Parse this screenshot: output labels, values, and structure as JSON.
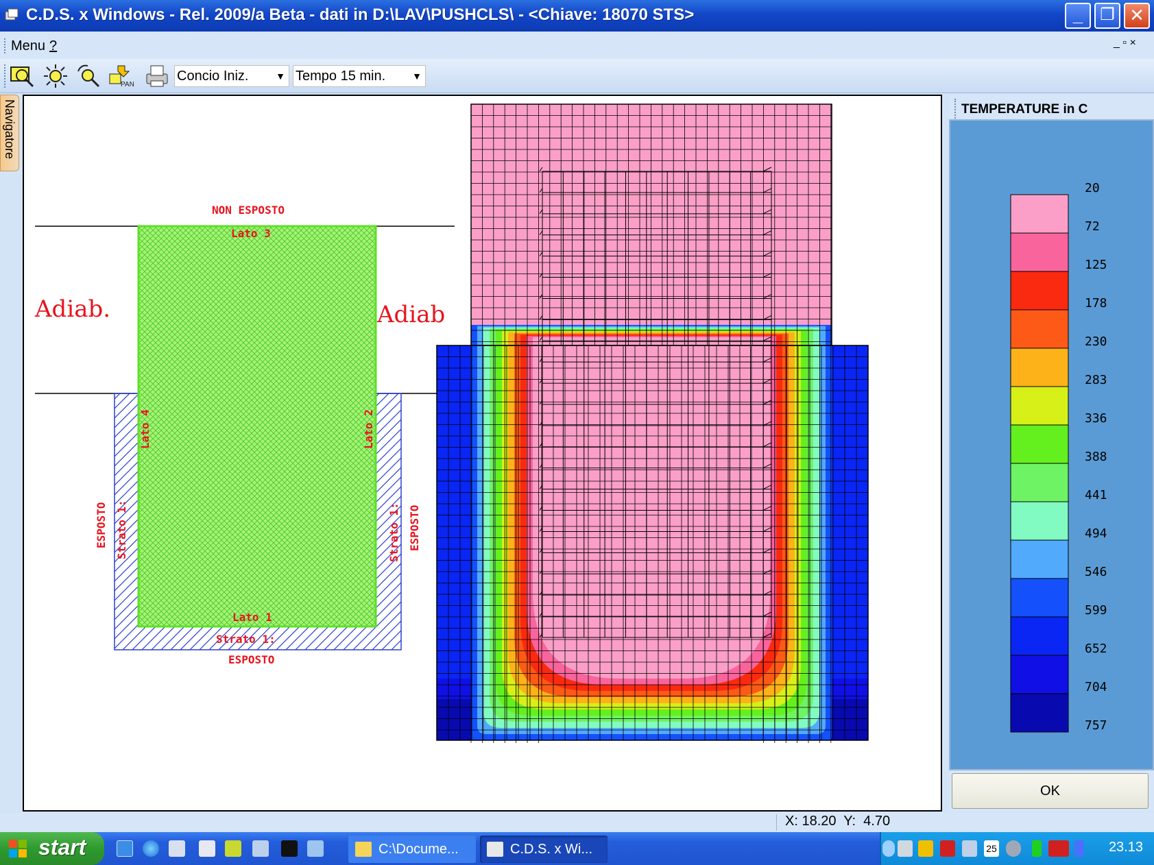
{
  "window": {
    "title": "C.D.S. x Windows - Rel. 2009/a Beta - dati in D:\\LAV\\PUSHCLS\\ - <Chiave: 18070 STS>",
    "minimize": "_",
    "maximize": "❐",
    "close": "✕"
  },
  "menubar": {
    "menu": "Menu",
    "help": "?",
    "mdi_controls": "_ ▫ ×"
  },
  "toolbar": {
    "buttons": [
      "zoom-window-icon",
      "zoom-all-icon",
      "zoom-dynamic-icon",
      "pan-icon",
      "print-icon"
    ],
    "pan_label": "PAN",
    "concio_select": "Concio Iniz.",
    "tempo_select": "Tempo 15 min."
  },
  "navigator_tab": "Navigatore",
  "drawing": {
    "labels": {
      "non_esposto": "NON ESPOSTO",
      "lato3": "Lato 3",
      "adiab_left": "Adiab.",
      "adiab_right": "Adiab",
      "lato4": "Lato 4",
      "lato2": "Lato 2",
      "esposto_left": "ESPOSTO",
      "strato_left": "Strato 1:",
      "esposto_right": "ESPOSTO",
      "strato_right": "Strato 1:",
      "lato1": "Lato 1",
      "strato_bottom": "Strato 1:",
      "esposto_bottom": "ESPOSTO"
    },
    "colors": {
      "section_fill": "#a6f27a",
      "section_border": "#5ce025",
      "hatch": "#2a3fd0",
      "label_red": "#e8141e"
    }
  },
  "legend": {
    "title": "TEMPERATURE in C",
    "values": [
      "20",
      "72",
      "125",
      "178",
      "230",
      "283",
      "336",
      "388",
      "441",
      "494",
      "546",
      "599",
      "652",
      "704",
      "757"
    ],
    "colors": [
      "#fb9fc8",
      "#f9649c",
      "#fa2a10",
      "#fc5a16",
      "#fcb218",
      "#d6f018",
      "#64f01e",
      "#6ef364",
      "#82fbc2",
      "#52aafc",
      "#1450fc",
      "#0a26f4",
      "#1010e6",
      "#080ab0"
    ],
    "ok_button": "OK"
  },
  "status": {
    "coords": "X: 18.20  Y:  4.70"
  },
  "taskbar": {
    "start": "start",
    "tasks": [
      "C:\\Docume...",
      "C.D.S. x Wi..."
    ],
    "clock": "23.13",
    "tray_day": "25"
  }
}
